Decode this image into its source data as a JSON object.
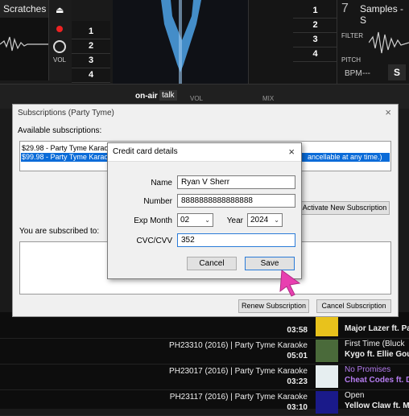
{
  "deck_left": {
    "title": "Scratches",
    "vol_label": "VOL"
  },
  "cue_buttons": [
    "1",
    "2",
    "3",
    "4"
  ],
  "center_buttons": [
    "1",
    "2",
    "3",
    "4"
  ],
  "deck_right": {
    "number": "7",
    "title": "Samples - S",
    "filter_label": "FILTER",
    "pitch_label": "PITCH",
    "bpm_label": "BPM",
    "bpm_value": "---",
    "s_button": "S"
  },
  "mixer": {
    "on_air": "on-air",
    "talk": "talk",
    "vol": "VOL",
    "mix": "MIX"
  },
  "tracks": [
    {
      "title": "",
      "duration": "03:58",
      "song": "",
      "artist": "Major Lazer ft. Pa",
      "song_color": "#ddd"
    },
    {
      "title": "PH23310 (2016) | Party Tyme Karaoke",
      "duration": "05:01",
      "song": "First Time (Bluck",
      "artist": "Kygo ft. Ellie Goul",
      "song_color": "#eee"
    },
    {
      "title": "PH23017 (2016) | Party Tyme Karaoke",
      "duration": "03:23",
      "song": "No Promises",
      "artist": "Cheat Codes ft. D",
      "song_color": "#b57cf0"
    },
    {
      "title": "PH23117 (2016) | Party Tyme Karaoke",
      "duration": "03:10",
      "song": "Open",
      "artist": "Yellow Claw ft. Mo",
      "song_color": "#eee"
    }
  ],
  "subscriptions": {
    "title": "Subscriptions (Party Tyme)",
    "close": "×",
    "available_label": "Available subscriptions:",
    "options": [
      "$29.98 - Party Tyme Karaoke",
      "$99.98 - Party Tyme Karaoke"
    ],
    "selected_option_tail": "ancellable at any time.)",
    "activate_label": "Activate New Subscription",
    "subscribed_label": "You are subscribed to:",
    "renew_label": "Renew Subscription",
    "cancel_label": "Cancel Subscription"
  },
  "credit_card": {
    "title": "Credit card details",
    "close": "×",
    "name_label": "Name",
    "name_value": "Ryan V Sherr",
    "number_label": "Number",
    "number_value": "8888888888888888",
    "exp_month_label": "Exp Month",
    "exp_month_value": "02",
    "year_label": "Year",
    "year_value": "2024",
    "cvv_label": "CVC/CVV",
    "cvv_value": "352",
    "cancel_label": "Cancel",
    "save_label": "Save"
  },
  "colors": {
    "accent_blue": "#2a7bd8",
    "selection": "#0a6bd8",
    "pointer": "#e83fb0",
    "waveform": "#4da3e8"
  }
}
